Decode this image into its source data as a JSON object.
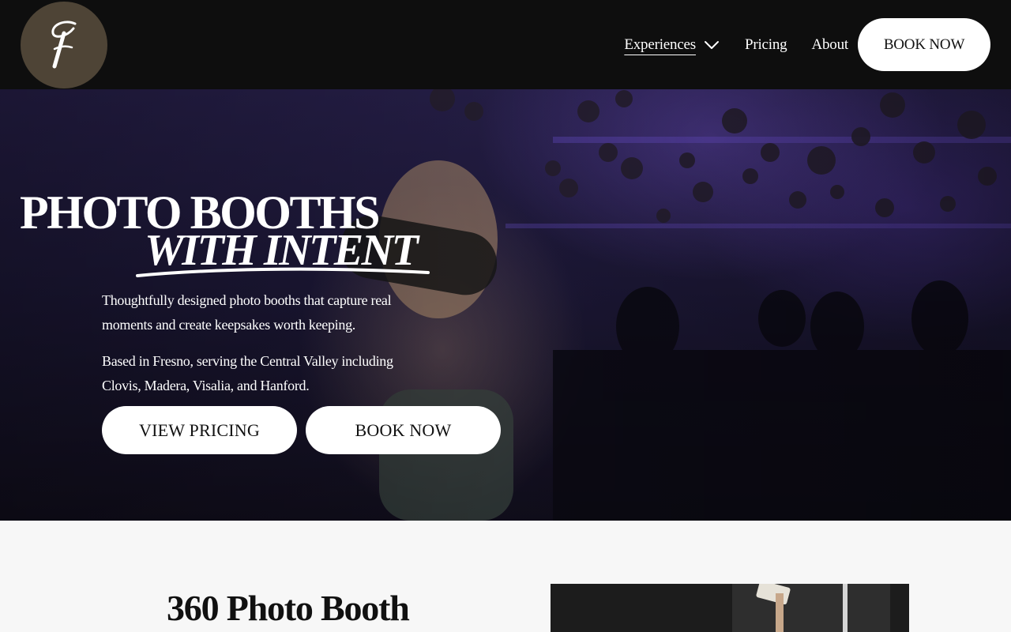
{
  "header": {
    "logo_icon": "script-f-monogram-icon",
    "logo_bg": "#4e4436",
    "nav": [
      {
        "label": "Experiences",
        "has_dropdown": true,
        "active": true
      },
      {
        "label": "Pricing"
      },
      {
        "label": "About"
      }
    ],
    "cta_label": "BOOK NOW"
  },
  "hero": {
    "title_line1": "PHOTO BOOTHS",
    "title_line2": "WITH INTENT",
    "description_1": "Thoughtfully designed photo booths that capture real moments and create keepsakes worth keeping.",
    "description_2": "Based in Fresno, serving the Central Valley including Clovis, Madera, Visalia, and Hanford.",
    "buttons": [
      {
        "label": "VIEW PRICING"
      },
      {
        "label": "BOOK NOW"
      }
    ]
  },
  "section": {
    "title": "360 Photo Booth"
  },
  "colors": {
    "header_bg": "#0e0e0e",
    "hero_accent": "#5b3fb3",
    "page_bg": "#f7f7f7",
    "button_bg": "#ffffff"
  }
}
